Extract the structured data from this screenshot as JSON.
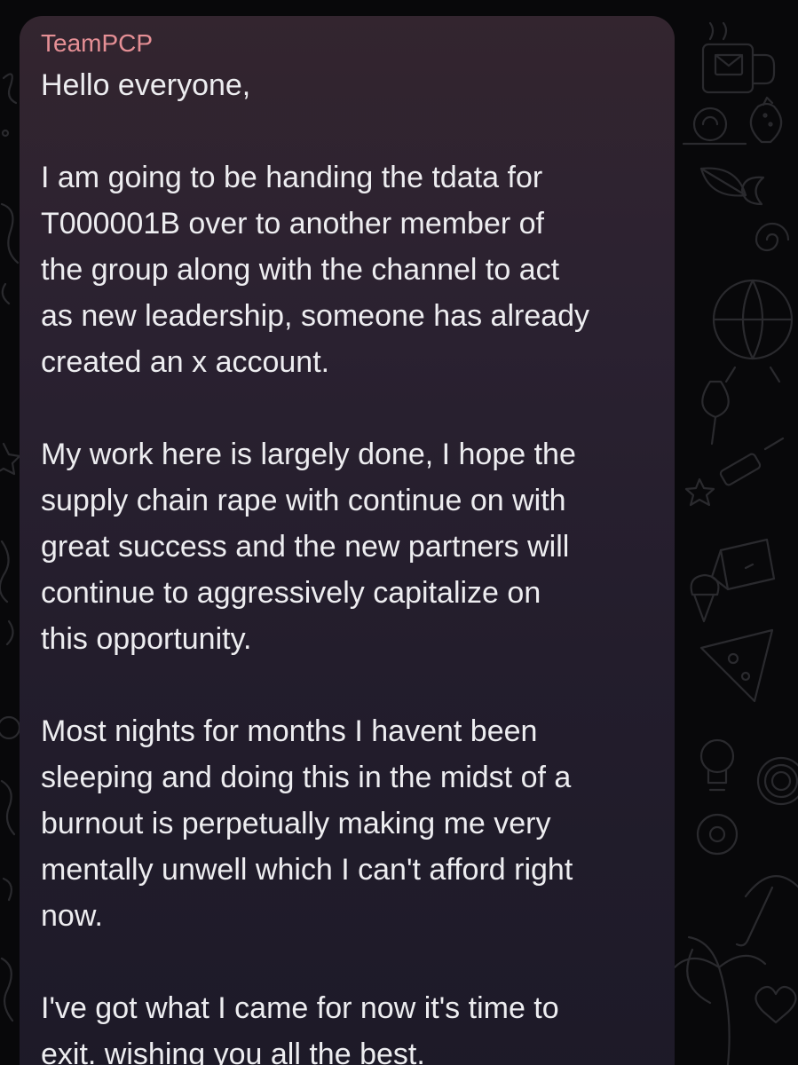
{
  "message": {
    "sender": "TeamPCP",
    "paragraphs": [
      "Hello everyone,",
      "I am going to be handing the tdata for\nT000001B over to another member of\nthe group along with the channel to act\nas new leadership, someone has already\ncreated an x account.",
      "My work here is largely done, I hope the\nsupply chain rape with continue on with\ngreat success and the new partners will\ncontinue to aggressively capitalize on\nthis opportunity.",
      "Most nights for months I havent been\nsleeping and doing this in the midst of a\nburnout is perpetually making me very\nmentally unwell which I can't afford right\nnow.",
      "I've got what I came for now it's time to\nexit. wishing you all the best."
    ]
  },
  "colors": {
    "sender_name": "#e58f95",
    "message_text": "#ededf0",
    "bubble_top": "#33252f",
    "bubble_bottom": "#1d1a28",
    "wallpaper": "#08080a"
  },
  "icons": {
    "wallpaper": [
      "mug-icon",
      "envelope-icon",
      "strawberry-icon",
      "snail-icon",
      "spiral-icon",
      "globe-icon",
      "star-icon",
      "cake-icon",
      "pizza-icon",
      "lightbulb-icon",
      "billiard-ball-icon",
      "umbrella-icon",
      "palm-tree-icon",
      "heart-icon"
    ]
  }
}
